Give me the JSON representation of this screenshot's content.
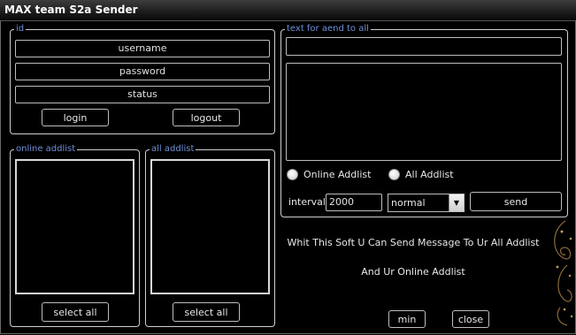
{
  "window": {
    "title": "MAX team S2a Sender"
  },
  "id_group": {
    "legend": "id",
    "username": "username",
    "password": "password",
    "status": "status",
    "login_label": "login",
    "logout_label": "logout"
  },
  "online_addlist": {
    "legend": "online addlist",
    "select_all_label": "select all"
  },
  "all_addlist": {
    "legend": "all addlist",
    "select_all_label": "select all"
  },
  "send_group": {
    "legend": "text for aend to all",
    "radio_online_label": "Online Addlist",
    "radio_all_label": "All Addlist",
    "interval_label": "interval :",
    "interval_value": "2000",
    "priority_value": "normal",
    "send_label": "send"
  },
  "info": {
    "line1": "Whit This Soft U Can Send Message To Ur All Addlist",
    "line2": "And Ur Online Addlist"
  },
  "buttons": {
    "min_label": "min",
    "close_label": "close"
  },
  "colors": {
    "background": "#000000",
    "legend": "#6f8fd9",
    "border": "#cfcfcf"
  }
}
